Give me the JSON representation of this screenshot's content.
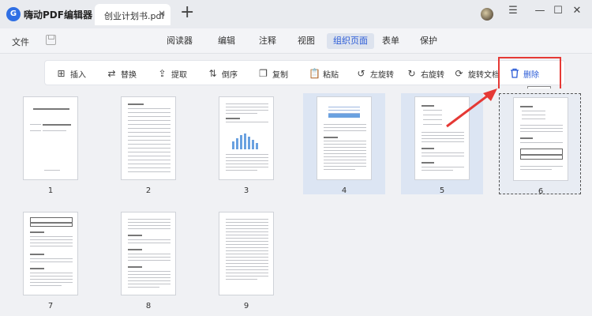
{
  "app": {
    "title": "嗨动PDF编辑器",
    "logo_text": "G"
  },
  "tab": {
    "label": "创业计划书.pdf",
    "close": "×",
    "add": "+"
  },
  "window": {
    "menu_icon": "☰",
    "minimize": "—",
    "maximize": "☐",
    "close": "✕"
  },
  "menubar": {
    "file": "文件",
    "tabs": [
      {
        "label": "阅读器",
        "active": false
      },
      {
        "label": "编辑",
        "active": false
      },
      {
        "label": "注释",
        "active": false
      },
      {
        "label": "视图",
        "active": false
      },
      {
        "label": "组织页面",
        "active": true
      },
      {
        "label": "表单",
        "active": false
      },
      {
        "label": "保护",
        "active": false
      }
    ]
  },
  "toolbar": {
    "tools": [
      {
        "label": "插入",
        "icon": "insert-icon",
        "glyph": "⊞"
      },
      {
        "label": "替换",
        "icon": "replace-icon",
        "glyph": "⇄"
      },
      {
        "label": "提取",
        "icon": "extract-icon",
        "glyph": "⇪"
      },
      {
        "label": "倒序",
        "icon": "reverse-icon",
        "glyph": "⇅"
      },
      {
        "label": "复制",
        "icon": "copy-icon",
        "glyph": "❐"
      },
      {
        "label": "粘贴",
        "icon": "paste-icon",
        "glyph": "📋"
      },
      {
        "label": "左旋转",
        "icon": "rotate-left-icon",
        "glyph": "↺"
      },
      {
        "label": "右旋转",
        "icon": "rotate-right-icon",
        "glyph": "↻"
      },
      {
        "label": "旋转文档",
        "icon": "rotate-doc-icon",
        "glyph": "⟳"
      },
      {
        "label": "删除",
        "icon": "trash-icon",
        "glyph": "🗑"
      }
    ],
    "tooltip": "删除"
  },
  "pages": [
    {
      "number": "1",
      "state": "normal",
      "kind": "cover"
    },
    {
      "number": "2",
      "state": "normal",
      "kind": "toc"
    },
    {
      "number": "3",
      "state": "normal",
      "kind": "chart"
    },
    {
      "number": "4",
      "state": "selected",
      "kind": "chart-top"
    },
    {
      "number": "5",
      "state": "selected",
      "kind": "text"
    },
    {
      "number": "6",
      "state": "dashed",
      "kind": "table"
    },
    {
      "number": "7",
      "state": "normal",
      "kind": "table-top"
    },
    {
      "number": "8",
      "state": "normal",
      "kind": "text"
    },
    {
      "number": "9",
      "state": "normal",
      "kind": "text-dense"
    }
  ],
  "colors": {
    "accent": "#2a5bd7",
    "highlight_red": "#e53935",
    "selection": "#dce5f3"
  }
}
